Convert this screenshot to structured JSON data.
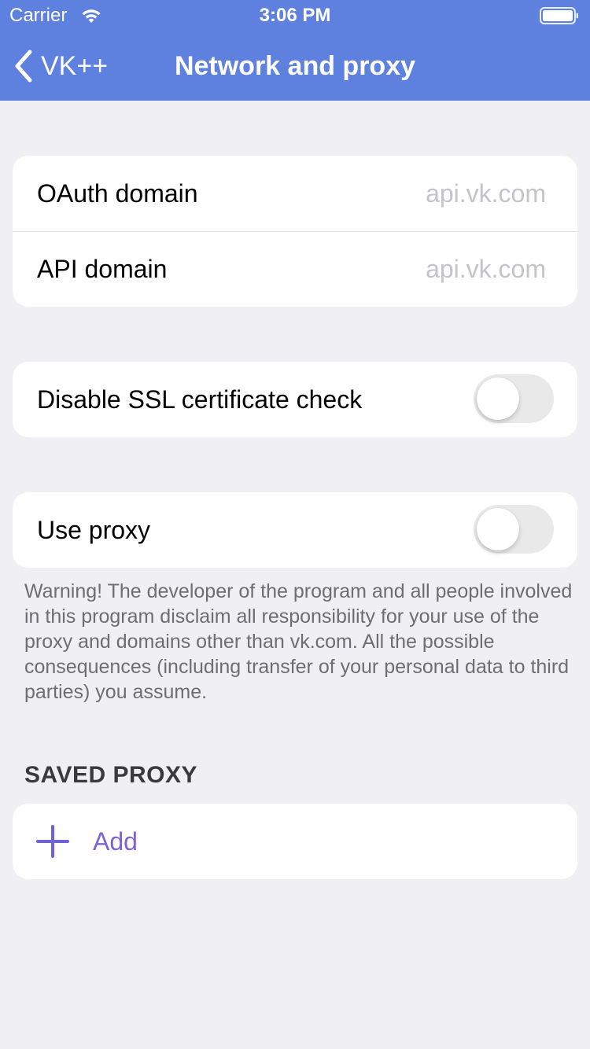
{
  "status_bar": {
    "carrier": "Carrier",
    "time": "3:06 PM",
    "wifi_icon": "wifi-icon",
    "battery_icon": "battery-icon"
  },
  "nav": {
    "back_label": "VK++",
    "back_icon": "chevron-left-icon",
    "title": "Network and proxy",
    "bar_color": "#5e81df"
  },
  "domains": {
    "oauth_label": "OAuth domain",
    "oauth_value": "api.vk.com",
    "api_label": "API domain",
    "api_value": "api.vk.com"
  },
  "ssl": {
    "label": "Disable SSL certificate check",
    "enabled": false
  },
  "proxy": {
    "label": "Use proxy",
    "enabled": false,
    "warning": "Warning! The developer of the program and all people involved in this program disclaim all responsibility for your use of the proxy and domains other than vk.com. All the possible consequences (including transfer of your personal data to third parties) you assume."
  },
  "saved_proxy": {
    "header": "SAVED PROXY",
    "add_label": "Add",
    "add_icon": "plus-icon",
    "accent_color": "#7d63d4"
  }
}
